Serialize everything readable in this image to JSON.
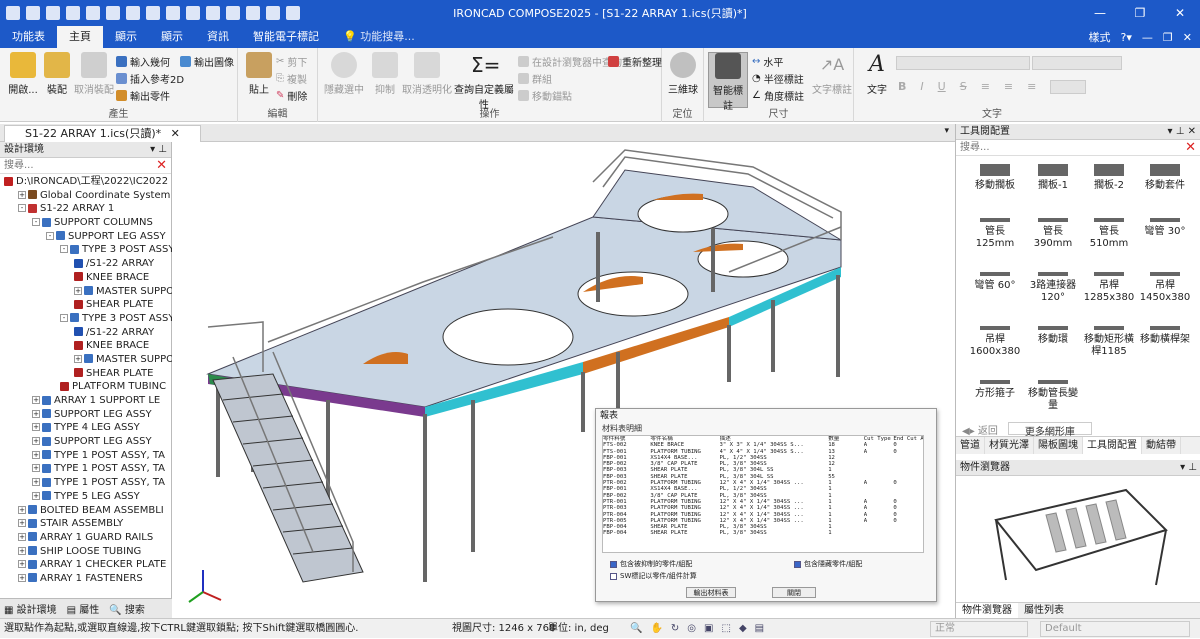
{
  "app": {
    "title": "IRONCAD COMPOSE2025 - [S1-22 ARRAY 1.ics(只讀)*]",
    "quick_access_icons": [
      "new-icon",
      "open-icon",
      "save-icon",
      "print-icon",
      "mail-icon",
      "grid-icon",
      "cut-icon",
      "undo-icon",
      "redo-icon",
      "globe-icon",
      "layout-icon",
      "tool-icon",
      "book-icon",
      "flag-icon",
      "down-icon"
    ]
  },
  "menu": {
    "tabs": [
      "功能表",
      "主頁",
      "顯示",
      "顯示",
      "資訊",
      "智能電子標記"
    ],
    "active_index": 1,
    "search_placeholder": "功能搜尋...",
    "style_label": "樣式"
  },
  "ribbon": {
    "produce": {
      "label": "產生",
      "open": "開啟...",
      "assemble": "裝配",
      "cancel_assemble": "取消裝配",
      "input_geometry": "輸入幾何",
      "insert_ref2d": "插入參考2D",
      "output_parts": "輸出零件",
      "output_image": "輸出圖像"
    },
    "edit": {
      "label": "編輯",
      "paste": "貼上",
      "cut": "剪下",
      "copy": "複製",
      "delete": "刪除"
    },
    "operate": {
      "label": "操作",
      "hide_selected": "隱藏選中",
      "suppress": "抑制",
      "cancel_transparent": "取消透明化",
      "query_custom": "查詢自定義屬性",
      "find_in_browser": "在設計瀏覽器中查詢",
      "regen": "重新整理",
      "group": "群組",
      "move_anchor": "移動錨點"
    },
    "position": {
      "label": "定位",
      "tri_ball": "三維球"
    },
    "dimension": {
      "label": "尺寸",
      "smart_dim": "智能標註",
      "horizontal": "水平",
      "radius": "半徑標註",
      "angle": "角度標註",
      "text_annotation": "文字標註"
    },
    "text": {
      "label": "文字",
      "text": "文字",
      "styles": [
        "B",
        "I",
        "U",
        "S"
      ]
    }
  },
  "document": {
    "tab": "S1-22 ARRAY 1.ics(只讀)*"
  },
  "left_panel": {
    "title": "設計環境",
    "search_placeholder": "搜尋...",
    "tree": [
      {
        "indent": 0,
        "label": "D:\\IRONCAD\\工程\\2022\\IC2022",
        "color": "#c02020",
        "pm": ""
      },
      {
        "indent": 1,
        "label": "Global Coordinate System",
        "color": "#7a4a20",
        "pm": "+"
      },
      {
        "indent": 1,
        "label": "S1-22 ARRAY 1",
        "color": "#c03030",
        "pm": "-"
      },
      {
        "indent": 2,
        "label": "SUPPORT COLUMNS",
        "color": "#3a70c0",
        "pm": "-"
      },
      {
        "indent": 3,
        "label": "SUPPORT LEG ASSY",
        "color": "#3a70c0",
        "pm": "-"
      },
      {
        "indent": 4,
        "label": "TYPE 3 POST ASSY",
        "color": "#3a70c0",
        "pm": "-"
      },
      {
        "indent": 5,
        "label": "/S1-22 ARRAY",
        "color": "#2050b0",
        "pm": ""
      },
      {
        "indent": 5,
        "label": "KNEE BRACE",
        "color": "#b02020",
        "pm": ""
      },
      {
        "indent": 5,
        "label": "MASTER SUPPO",
        "color": "#3a70c0",
        "pm": "+"
      },
      {
        "indent": 5,
        "label": "SHEAR PLATE",
        "color": "#b02020",
        "pm": ""
      },
      {
        "indent": 4,
        "label": "TYPE 3 POST ASSY",
        "color": "#3a70c0",
        "pm": "-"
      },
      {
        "indent": 5,
        "label": "/S1-22 ARRAY",
        "color": "#2050b0",
        "pm": ""
      },
      {
        "indent": 5,
        "label": "KNEE BRACE",
        "color": "#b02020",
        "pm": ""
      },
      {
        "indent": 5,
        "label": "MASTER SUPPO",
        "color": "#3a70c0",
        "pm": "+"
      },
      {
        "indent": 5,
        "label": "SHEAR PLATE",
        "color": "#b02020",
        "pm": ""
      },
      {
        "indent": 4,
        "label": "PLATFORM TUBINC",
        "color": "#b02020",
        "pm": ""
      },
      {
        "indent": 2,
        "label": "ARRAY 1 SUPPORT LE",
        "color": "#3a70c0",
        "pm": "+"
      },
      {
        "indent": 2,
        "label": "SUPPORT LEG ASSY",
        "color": "#3a70c0",
        "pm": "+"
      },
      {
        "indent": 2,
        "label": "TYPE 4 LEG ASSY",
        "color": "#3a70c0",
        "pm": "+"
      },
      {
        "indent": 2,
        "label": "SUPPORT LEG ASSY",
        "color": "#3a70c0",
        "pm": "+"
      },
      {
        "indent": 2,
        "label": "TYPE 1 POST ASSY, TA",
        "color": "#3a70c0",
        "pm": "+"
      },
      {
        "indent": 2,
        "label": "TYPE 1 POST ASSY, TA",
        "color": "#3a70c0",
        "pm": "+"
      },
      {
        "indent": 2,
        "label": "TYPE 1 POST ASSY, TA",
        "color": "#3a70c0",
        "pm": "+"
      },
      {
        "indent": 2,
        "label": "TYPE 5 LEG ASSY",
        "color": "#3a70c0",
        "pm": "+"
      },
      {
        "indent": 1,
        "label": "BOLTED BEAM ASSEMBLI",
        "color": "#3a70c0",
        "pm": "+"
      },
      {
        "indent": 1,
        "label": "STAIR ASSEMBLY",
        "color": "#3a70c0",
        "pm": "+"
      },
      {
        "indent": 1,
        "label": "ARRAY 1 GUARD RAILS",
        "color": "#3a70c0",
        "pm": "+"
      },
      {
        "indent": 1,
        "label": "SHIP LOOSE TUBING",
        "color": "#3a70c0",
        "pm": "+"
      },
      {
        "indent": 1,
        "label": "ARRAY 1 CHECKER PLATE",
        "color": "#3a70c0",
        "pm": "+"
      },
      {
        "indent": 1,
        "label": "ARRAY 1 FASTENERS",
        "color": "#3a70c0",
        "pm": "+"
      }
    ],
    "bottom_tabs": [
      "設計環境",
      "屬性",
      "搜索"
    ]
  },
  "right_panel": {
    "title": "工具閱配置",
    "search_placeholder": "搜尋...",
    "catalog": [
      {
        "label": "移動擱板"
      },
      {
        "label": "擱板-1"
      },
      {
        "label": "擱板-2"
      },
      {
        "label": "移動套件"
      },
      {
        "label": "管長\n125mm"
      },
      {
        "label": "管長\n390mm"
      },
      {
        "label": "管長\n510mm"
      },
      {
        "label": "彎管 30°"
      },
      {
        "label": "彎管 60°"
      },
      {
        "label": "3路連接器\n120°"
      },
      {
        "label": "吊桿\n1285x380"
      },
      {
        "label": "吊桿\n1450x380"
      },
      {
        "label": "吊桿\n1600x380"
      },
      {
        "label": "移動環"
      },
      {
        "label": "移動矩形橫\n桿1185"
      },
      {
        "label": "移動橫桿架"
      },
      {
        "label": "方形箍子"
      },
      {
        "label": "移動管長變\n量"
      }
    ],
    "nav_back": "返回",
    "more_links": "更多網形庫",
    "catalog_tabs": [
      "管道",
      "材質光澤",
      "陽板圖塊",
      "工具閱配置",
      "動結帶"
    ],
    "active_catalog_tab": 3,
    "browser_title": "物件瀏覽器",
    "browser_tabs": [
      "物件瀏覽器",
      "屬性列表"
    ]
  },
  "bom_dialog": {
    "title": "報表",
    "subtitle": "材料表明細",
    "headers": [
      "零件料號",
      "零件名稱",
      "描述",
      "數量",
      "Cut Type",
      "End Cut Angle"
    ],
    "rows": [
      [
        "FTS-002",
        "KNEE BRACE",
        "3\" X 3\" X 1/4\" 304SS S...",
        "18",
        "A",
        "0"
      ],
      [
        "FTS-001",
        "PLATFORM TUBING",
        "4\" X 4\" X 1/4\" 304SS S...",
        "13",
        "A",
        "0"
      ],
      [
        "FBP-001",
        "XS14X4 BASE...",
        "PL, 1/2\" 304SS",
        "12",
        "",
        " "
      ],
      [
        "FBP-002",
        "3/8\" CAP PLATE",
        "PL, 3/8\" 304SS",
        "12",
        "",
        " "
      ],
      [
        "FBP-003",
        "SHEAR PLATE",
        "PL, 3/8\" 304L SS",
        "1",
        "",
        " "
      ],
      [
        "FBP-003",
        "SHEAR PLATE",
        "PL, 3/8\" 304L SS",
        "55",
        "",
        " "
      ],
      [
        "PTR-002",
        "PLATFORM TUBING",
        "12\" X 4\" X 1/4\" 304SS ...",
        "1",
        "A",
        "0"
      ],
      [
        "FBP-001",
        "XS14X4 BASE...",
        "PL, 1/2\" 304SS",
        "1",
        "",
        " "
      ],
      [
        "FBP-002",
        "3/8\" CAP PLATE",
        "PL, 3/8\" 304SS",
        "1",
        "",
        " "
      ],
      [
        "PTR-001",
        "PLATFORM TUBING",
        "12\" X 4\" X 1/4\" 304SS ...",
        "1",
        "A",
        "0"
      ],
      [
        "PTR-003",
        "PLATFORM TUBING",
        "12\" X 4\" X 1/4\" 304SS ...",
        "1",
        "A",
        "0"
      ],
      [
        "PTR-004",
        "PLATFORM TUBING",
        "12\" X 4\" X 1/4\" 304SS ...",
        "1",
        "A",
        "0"
      ],
      [
        "PTR-005",
        "PLATFORM TUBING",
        "12\" X 4\" X 1/4\" 304SS ...",
        "1",
        "A",
        "0"
      ],
      [
        "FBP-004",
        "SHEAR PLATE",
        "PL, 3/8\" 304SS",
        "1",
        "",
        " "
      ],
      [
        "FBP-004",
        "SHEAR PLATE",
        "PL, 3/8\" 304SS",
        "1",
        "",
        " "
      ]
    ],
    "check1": "包含被抑制的零件/組配",
    "check2": "包含隱藏零件/組配",
    "check3": "SW標記以零件/組件計算",
    "btn_output": "輸出材料表",
    "btn_close": "關閉"
  },
  "status": {
    "hint": "選取點作為起點,或選取直線邊,按下CTRL鍵選取鎖點; 按下Shift鍵選取橋圓圓心.",
    "view_size": "視圖尺寸: 1246 x  768",
    "units": "單位:  in, deg",
    "render_mode": "正常",
    "style_default": "Default"
  }
}
